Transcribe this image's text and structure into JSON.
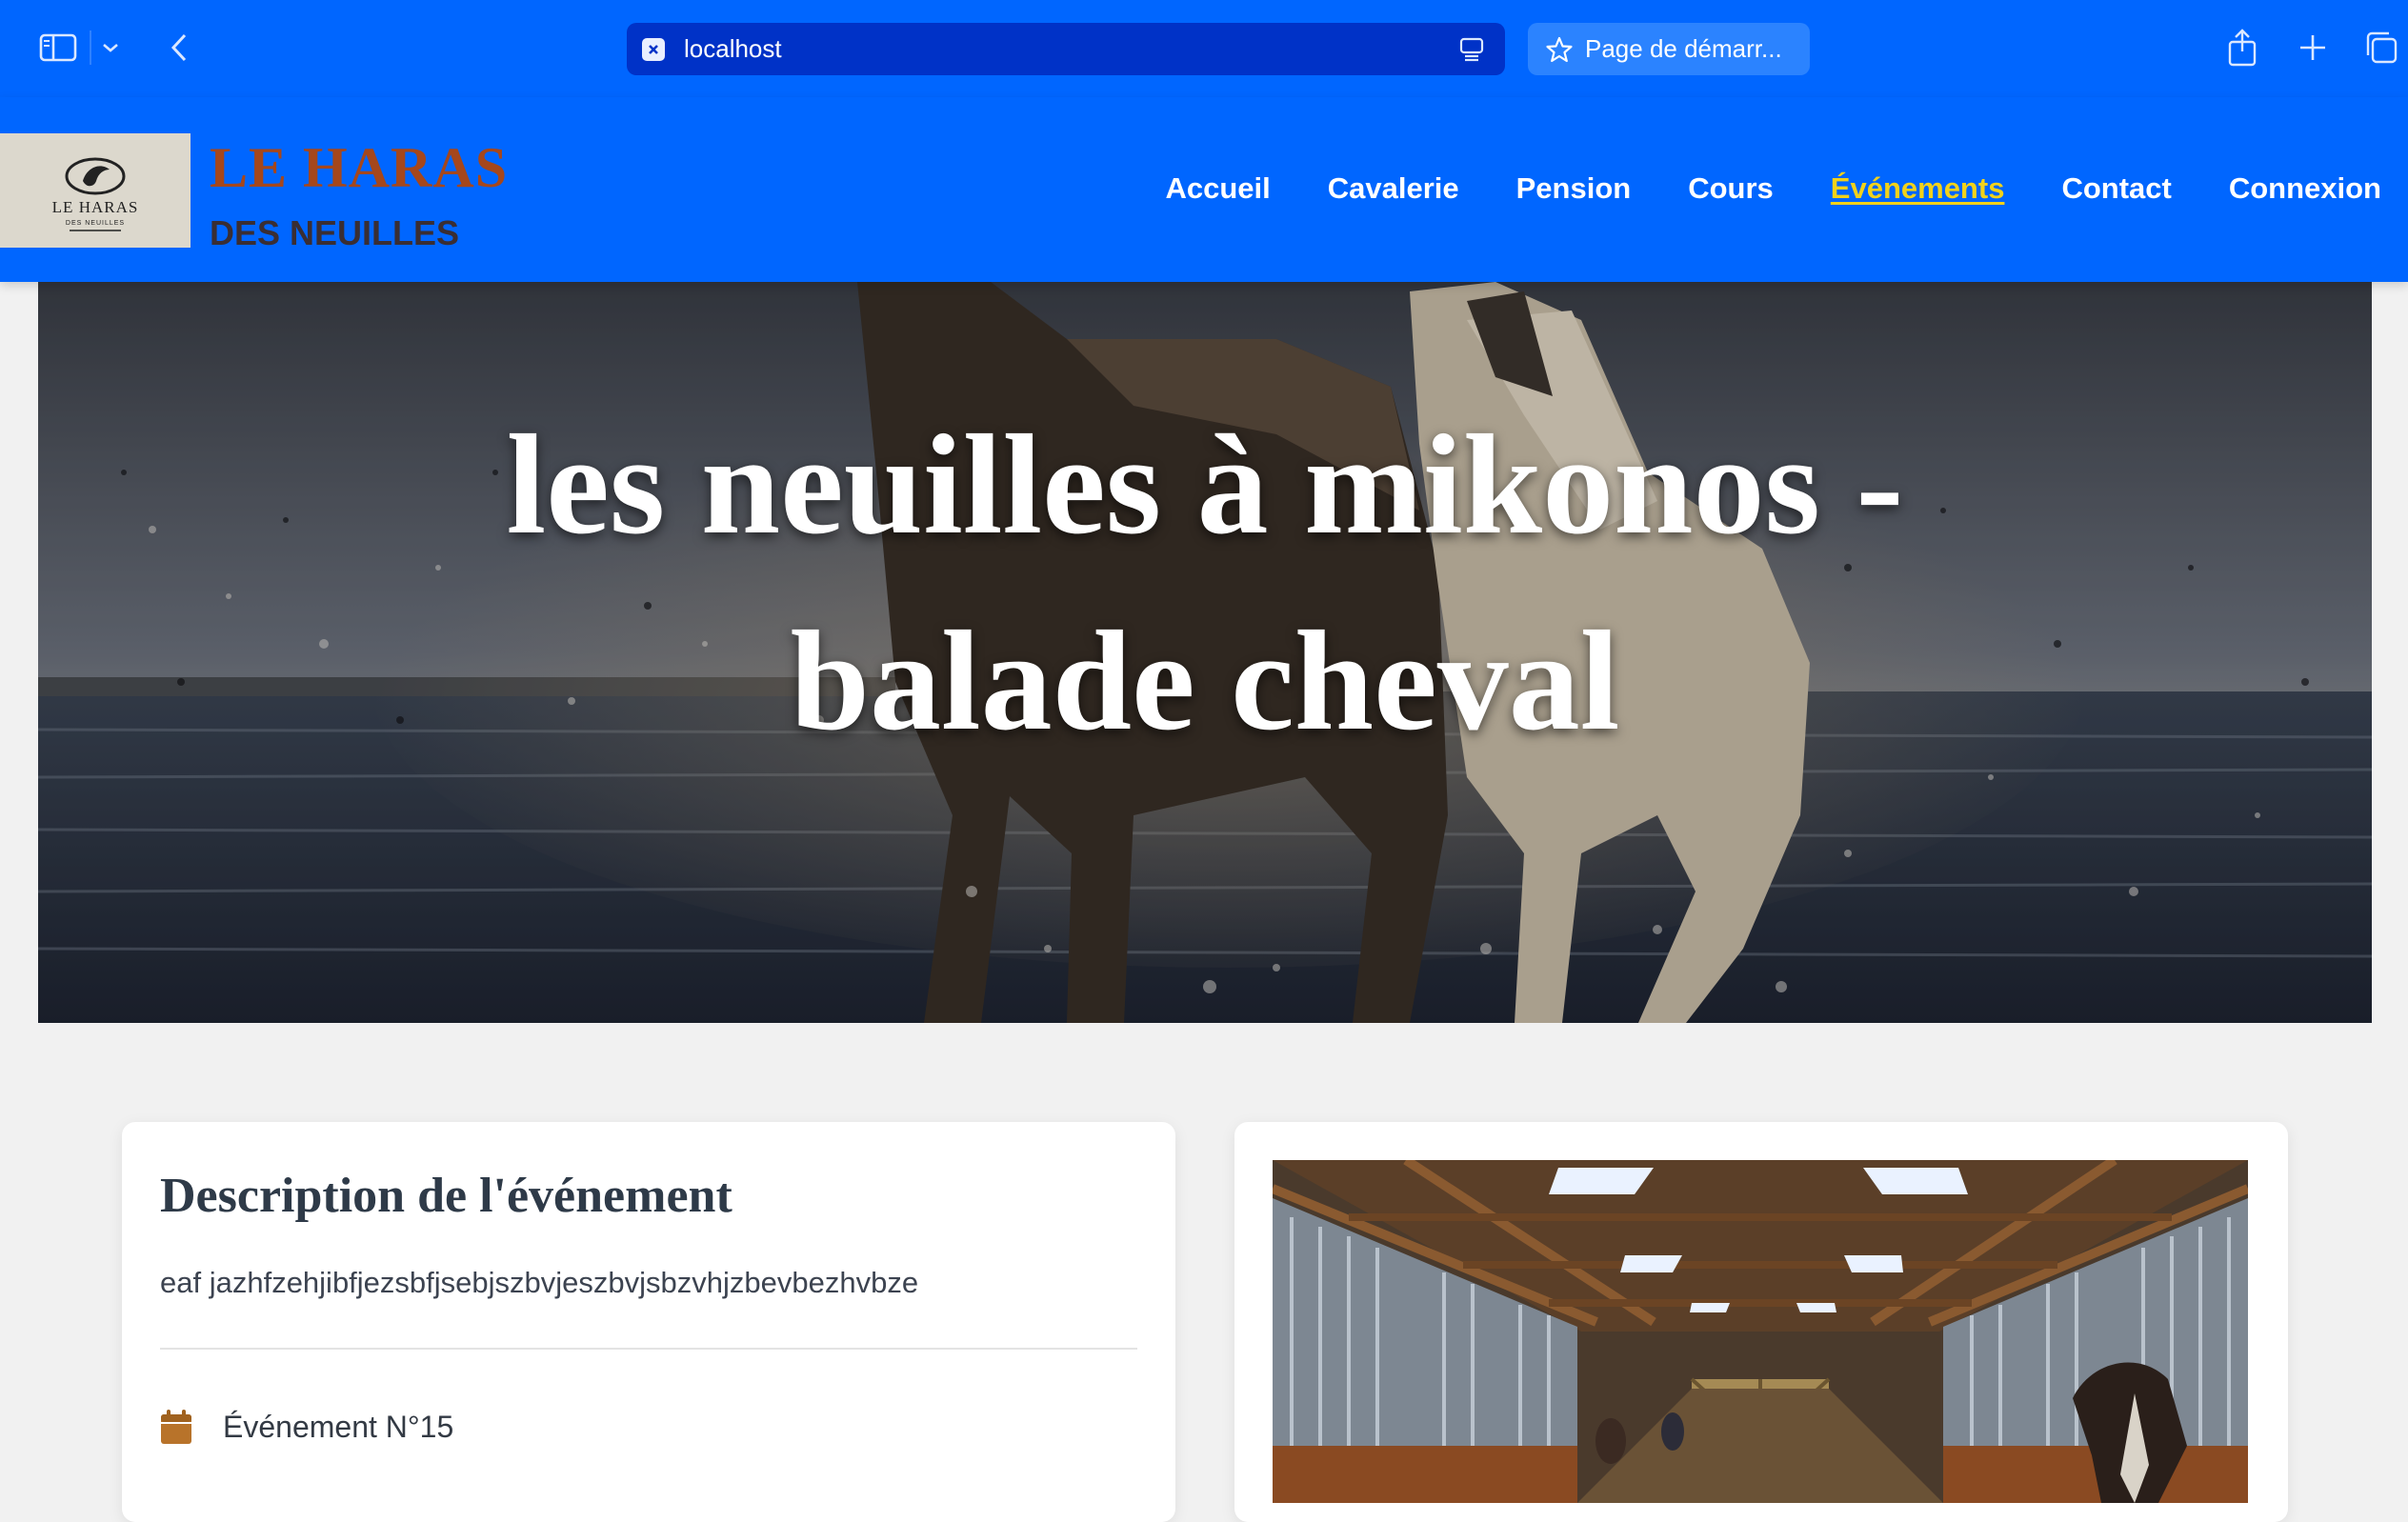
{
  "browser": {
    "address": "localhost",
    "bookmark_label": "Page de démarr..."
  },
  "site": {
    "brand_line1": "LE HARAS",
    "brand_line2": "DES NEUILLES",
    "logo_text_main": "LE HARAS",
    "logo_text_sub": "DES NEUILLES",
    "nav": [
      {
        "label": "Accueil",
        "active": false
      },
      {
        "label": "Cavalerie",
        "active": false
      },
      {
        "label": "Pension",
        "active": false
      },
      {
        "label": "Cours",
        "active": false
      },
      {
        "label": "Événements",
        "active": true
      },
      {
        "label": "Contact",
        "active": false
      },
      {
        "label": "Connexion",
        "active": false
      }
    ],
    "accent_color": "#f2d21a"
  },
  "hero": {
    "title_line1": "les neuilles à mikonos -",
    "title_line2": "balade cheval"
  },
  "description": {
    "title": "Description de l'événement",
    "text": "eaf jazhfzehjibfjezsbfjsebjszbvjeszbvjsbzvhjzbevbezhvbze",
    "event_label": "Événement N°15"
  }
}
